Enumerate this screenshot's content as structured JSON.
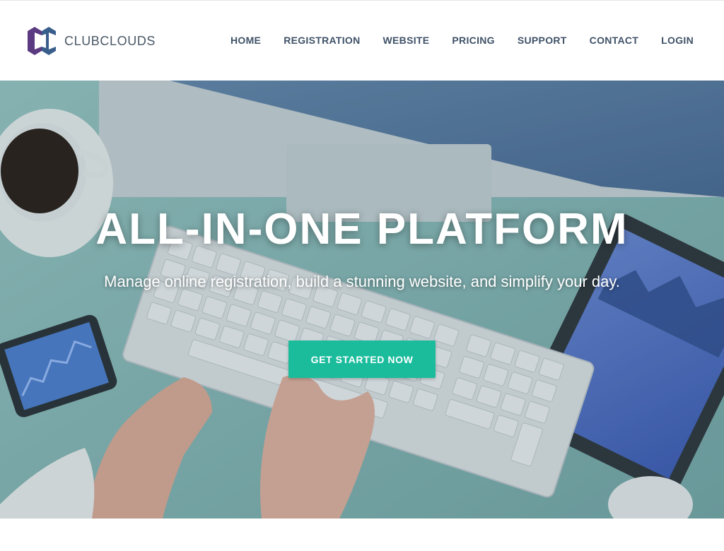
{
  "brand": {
    "name": "CLUBCLOUDS",
    "logo_icon": "clubclouds-logo-icon",
    "logo_colors": [
      "#5b3a82",
      "#3a5e8c"
    ]
  },
  "nav": {
    "items": [
      {
        "label": "HOME"
      },
      {
        "label": "REGISTRATION"
      },
      {
        "label": "WEBSITE"
      },
      {
        "label": "PRICING"
      },
      {
        "label": "SUPPORT"
      },
      {
        "label": "CONTACT"
      },
      {
        "label": "LOGIN"
      }
    ]
  },
  "hero": {
    "title": "ALL-IN-ONE PLATFORM",
    "subtitle": "Manage online registration, build a stunning website, and simplify your day.",
    "cta_label": "GET STARTED NOW",
    "background_scene": "desk-with-keyboard-monitor-tablet-phone-coffee",
    "accent_color": "#1abc9c"
  }
}
